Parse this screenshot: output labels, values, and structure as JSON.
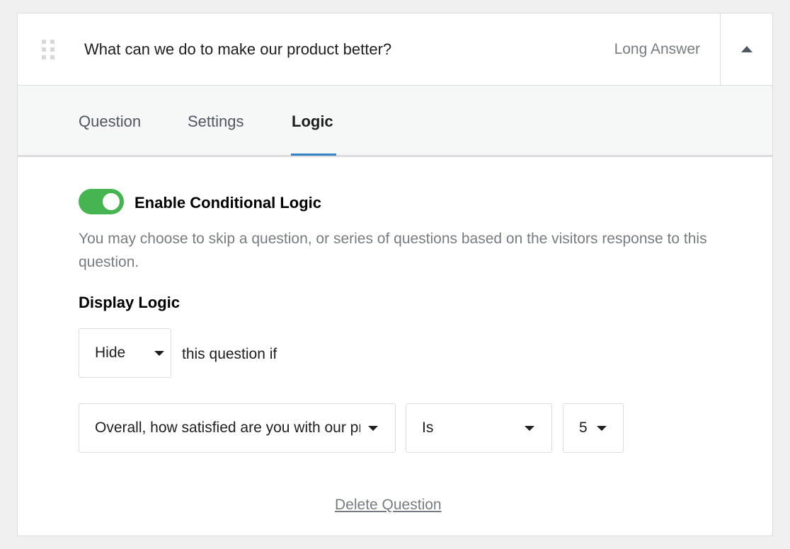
{
  "question": {
    "title": "What can we do to make our product better?",
    "type": "Long Answer"
  },
  "tabs": [
    {
      "label": "Question",
      "active": false
    },
    {
      "label": "Settings",
      "active": false
    },
    {
      "label": "Logic",
      "active": true
    }
  ],
  "logic": {
    "toggle_label": "Enable Conditional Logic",
    "toggle_on": true,
    "help_text": "You may choose to skip a question, or series of questions based on the visitors response to this question.",
    "display_heading": "Display Logic",
    "action_select": "Hide",
    "connector_text": "this question if",
    "rule": {
      "question_select": "Overall, how satisfied are you with our product?",
      "operator_select": "Is",
      "value_select": "5"
    }
  },
  "delete_label": "Delete Question",
  "colors": {
    "accent": "#3582c4",
    "toggle_on": "#46b450",
    "muted_text": "#787c82"
  },
  "icons": [
    "drag-handle-icon",
    "collapse-arrow-icon",
    "dropdown-caret-icon"
  ]
}
